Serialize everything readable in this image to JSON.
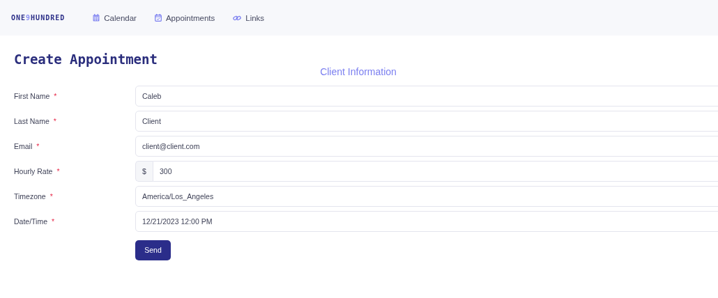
{
  "nav": {
    "logo": [
      {
        "text": "ONE",
        "accent": false
      },
      {
        "text": "9",
        "accent": true
      },
      {
        "text": "HUNDRED",
        "accent": false
      }
    ],
    "items": [
      {
        "label": "Calendar",
        "kind": "calendar"
      },
      {
        "label": "Appointments",
        "kind": "calendar-check"
      },
      {
        "label": "Links",
        "kind": "link"
      }
    ]
  },
  "page": {
    "title": "Create Appointment",
    "section": "Client Information"
  },
  "fields": [
    {
      "label": "First Name",
      "required_mark": "*",
      "value": "Caleb"
    },
    {
      "label": "Last Name",
      "required_mark": "*",
      "value": "Client"
    },
    {
      "label": "Email",
      "required_mark": "*",
      "value": "client@client.com"
    },
    {
      "label": "Hourly Rate",
      "required_mark": "*",
      "prefix": "$",
      "value": "300"
    },
    {
      "label": "Timezone",
      "required_mark": "*",
      "value": "America/Los_Angeles"
    },
    {
      "label": "Date/Time",
      "required_mark": "*",
      "value": "12/21/2023 12:00 PM"
    }
  ],
  "submit": "Send"
}
